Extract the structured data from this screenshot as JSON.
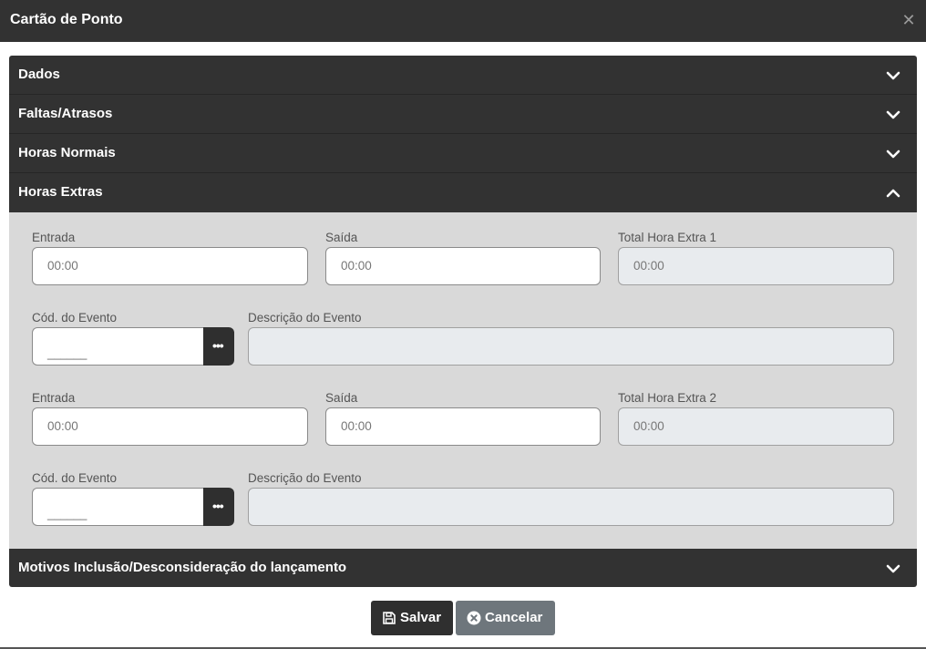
{
  "dialog": {
    "title": "Cartão de Ponto",
    "close_icon": "close-icon"
  },
  "sections": [
    {
      "label": "Dados",
      "state": "collapsed"
    },
    {
      "label": "Faltas/Atrasos",
      "state": "collapsed"
    },
    {
      "label": "Horas Normais",
      "state": "collapsed"
    },
    {
      "label": "Horas Extras",
      "state": "expanded"
    },
    {
      "label": "Motivos Inclusão/Desconsideração do lançamento",
      "state": "collapsed"
    }
  ],
  "extra1": {
    "entrada_label": "Entrada",
    "entrada_placeholder": "00:00",
    "saida_label": "Saída",
    "saida_placeholder": "00:00",
    "total_label": "Total Hora Extra 1",
    "total_placeholder": "00:00",
    "cod_label": "Cód. do Evento",
    "cod_value": "______",
    "desc_label": "Descrição do Evento",
    "desc_value": ""
  },
  "extra2": {
    "entrada_label": "Entrada",
    "entrada_placeholder": "00:00",
    "saida_label": "Saída",
    "saida_placeholder": "00:00",
    "total_label": "Total Hora Extra 2",
    "total_placeholder": "00:00",
    "cod_label": "Cód. do Evento",
    "cod_value": "______",
    "desc_label": "Descrição do Evento",
    "desc_value": ""
  },
  "lookup_button_glyph": "•••",
  "footer": {
    "save_label": "Salvar",
    "cancel_label": "Cancelar"
  },
  "colors": {
    "header_bg": "#323232",
    "panel_bg": "#d9d9d9",
    "readonly_bg": "#e8ebee",
    "cancel_bg": "#6e767c"
  }
}
